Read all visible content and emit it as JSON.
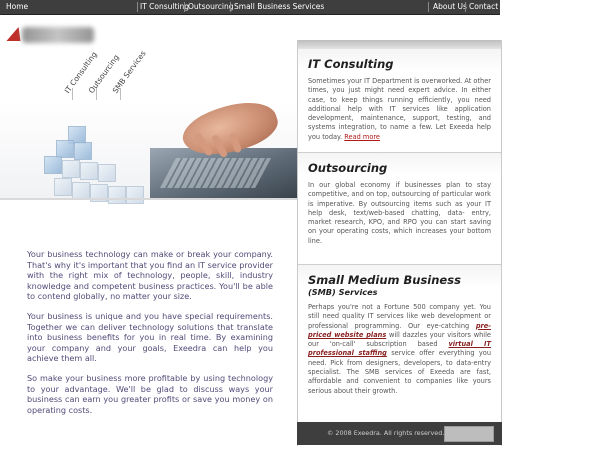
{
  "nav": {
    "left": [
      {
        "label": "Home"
      },
      {
        "label": "IT Consulting"
      },
      {
        "label": "Outsourcing"
      },
      {
        "label": "Small Business Services"
      }
    ],
    "right": [
      {
        "label": "About Us"
      },
      {
        "label": "Contact"
      }
    ]
  },
  "logo": {
    "text": "Exeedra"
  },
  "hero": {
    "diagonal_labels": [
      "IT Consulting",
      "Outsourcing",
      "SMB Services"
    ]
  },
  "left_paragraphs": [
    "Your business technology can make or break your company. That's why it's important that you find an IT service provider with the right mix of technology, people, skill, industry knowledge and competent business practices. You'll be able to contend globally, no matter your size.",
    "Your business is unique and you have special requirements. Together we can deliver technology solutions that translate into business benefits for you in real time. By examining your company and your goals, Exeedra can help you achieve them all.",
    "So make your business more profitable by using technology to your advantage. We'll be glad to discuss ways your business can earn you greater profits or save you money on operating costs."
  ],
  "sections": {
    "it": {
      "title": "IT Consulting",
      "body": "Sometimes your IT Department is overworked. At other times, you just might need expert advice. In either case, to keep things running efficiently, you need additional help with IT services like application development, maintenance, support, testing, and systems integration, to name a few. Let Exeeda help you today.",
      "link": "Read more"
    },
    "out": {
      "title": "Outsourcing",
      "body": "In our global economy if businesses plan to stay competitive, and on top, outsourcing of particular work is imperative. By outsourcing items such as your IT help desk, text/web-based chatting, data- entry, market research, KPO, and RPO you can start saving on your operating costs, which increases your bottom line."
    },
    "smb": {
      "title": "Small Medium Business",
      "subtitle": "(SMB) Services",
      "body_a": "Perhaps you're not a Fortune 500 company yet. You still need quality IT services like web development or professional programming. Our eye-catching ",
      "hl_a": "pre-priced website plans",
      "body_b": " will dazzles your visitors while our 'on-call' subscription based ",
      "hl_b": "virtual IT professional staffing",
      "body_c": " service offer everything you need. Pick from designers, developers, to data-entry specialist. The SMB services of Exeeda are fast, affordable and convenient to companies like yours serious about their growth."
    }
  },
  "footer": {
    "copyright": "© 2008 Exeedra. All rights reserved."
  },
  "colors": {
    "nav_bg": "#3e3e3e",
    "body_text": "#524a78",
    "link": "#b21818",
    "accent_red": "#c0302a"
  }
}
